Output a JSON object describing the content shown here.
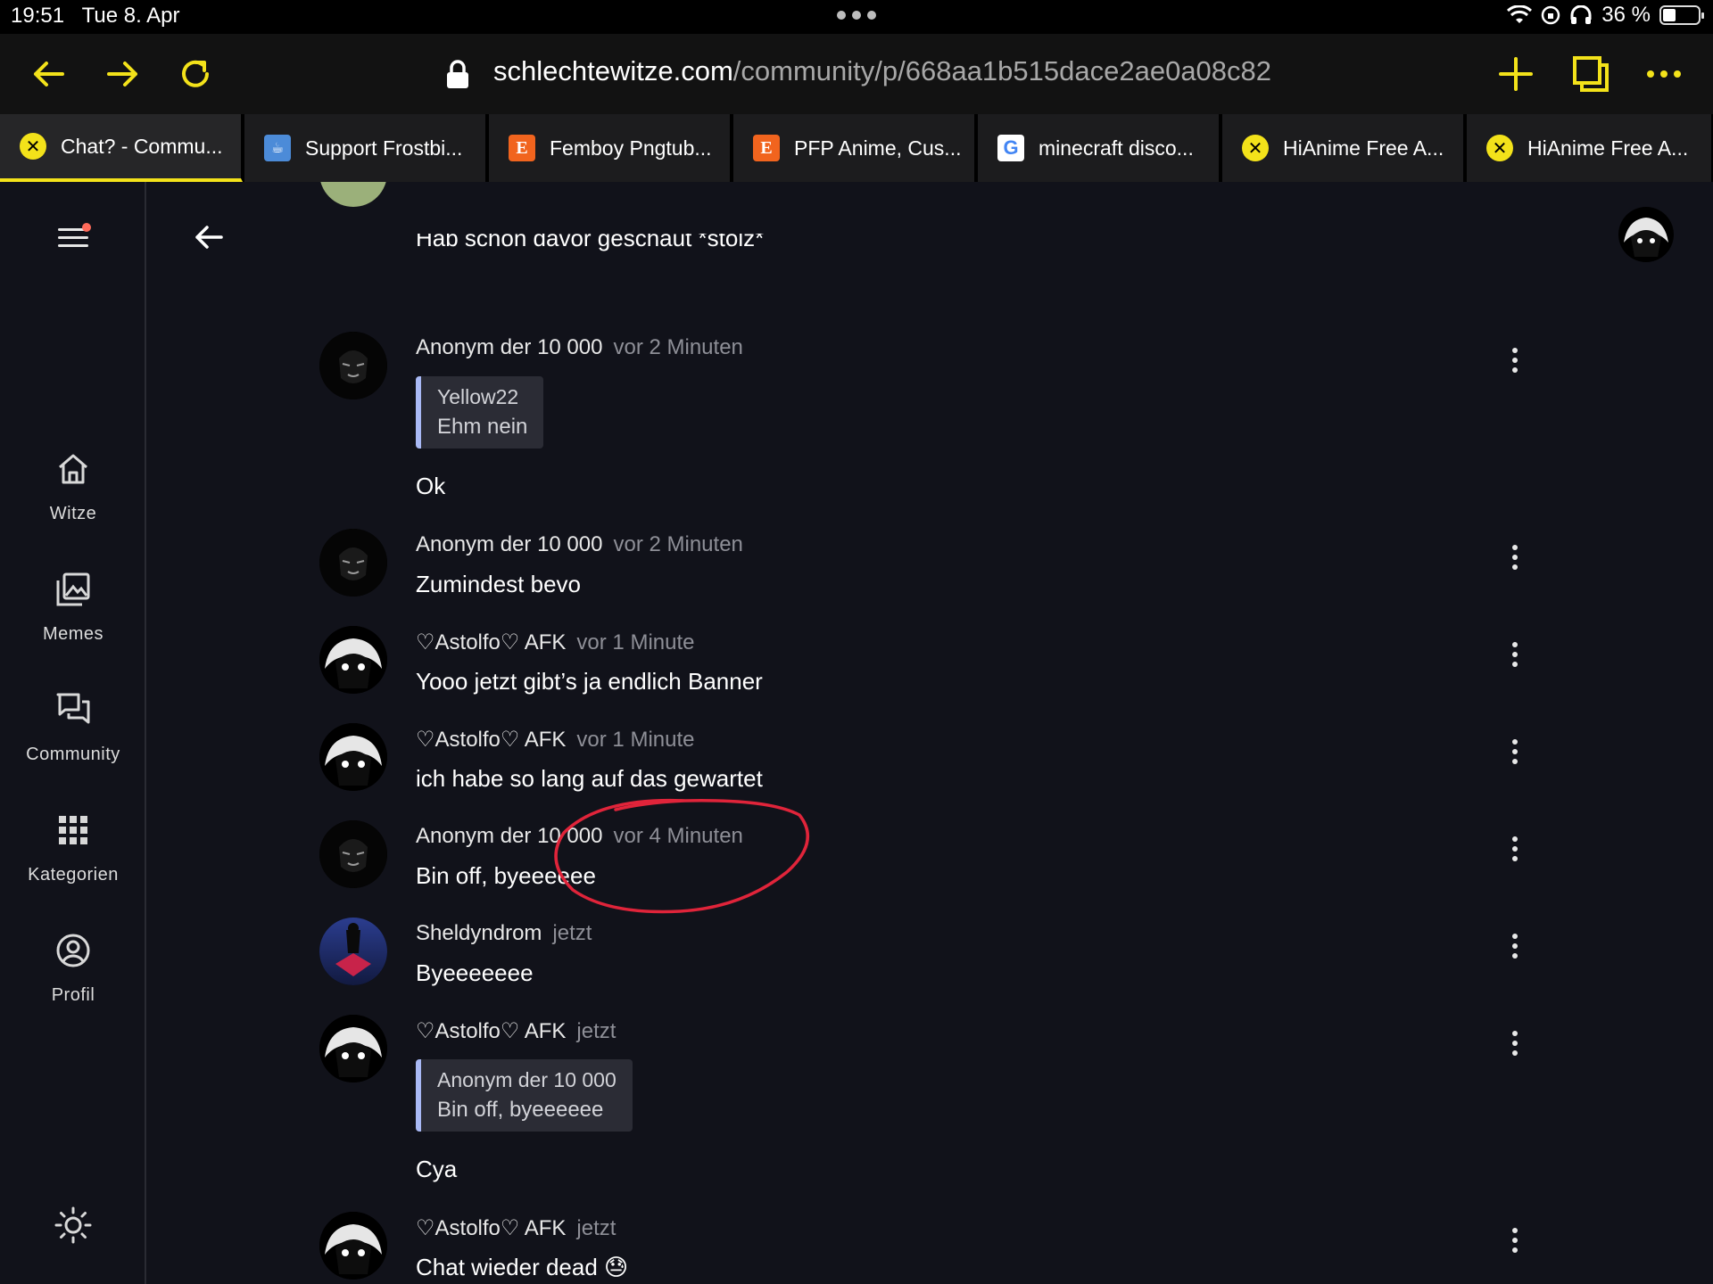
{
  "status_bar": {
    "time": "19:51",
    "date": "Tue 8. Apr",
    "battery": "36 %",
    "battery_level": 0.36
  },
  "browser": {
    "url_domain": "schlechtewitze.com",
    "url_path": "/community/p/668aa1b515dace2ae0a08c82",
    "accent_color": "#f3e21a",
    "tabs": [
      {
        "label": "Chat? - Commu...",
        "favicon": "x-circle-icon",
        "active": true
      },
      {
        "label": "Support Frostbi...",
        "favicon": "kofi-cup-icon"
      },
      {
        "label": "Femboy Pngtub...",
        "favicon": "etsy-icon"
      },
      {
        "label": "PFP Anime, Cus...",
        "favicon": "etsy-icon"
      },
      {
        "label": "minecraft disco...",
        "favicon": "google-icon"
      },
      {
        "label": "HiAnime Free A...",
        "favicon": "x-circle-icon"
      },
      {
        "label": "HiAnime Free A...",
        "favicon": "x-circle-icon"
      }
    ]
  },
  "sidebar": {
    "items": [
      {
        "label": "Witze",
        "icon": "home-icon"
      },
      {
        "label": "Memes",
        "icon": "images-icon"
      },
      {
        "label": "Community",
        "icon": "chat-bubbles-icon"
      },
      {
        "label": "Kategorien",
        "icon": "grid-icon"
      },
      {
        "label": "Profil",
        "icon": "user-circle-icon"
      }
    ]
  },
  "messages": [
    {
      "text": "Hab schon davor geschaut *stolz*"
    },
    {
      "author": "Anonym der 10 000",
      "time": "vor 2 Minuten",
      "quote_author": "Yellow22",
      "quote_text": "Ehm nein",
      "text": "Ok"
    },
    {
      "author": "Anonym der 10 000",
      "time": "vor 2 Minuten",
      "text": "Zumindest bevo"
    },
    {
      "author": "♡Astolfo♡ AFK",
      "time": "vor 1 Minute",
      "text": "Yooo jetzt gibt’s ja endlich Banner"
    },
    {
      "author": "♡Astolfo♡ AFK",
      "time": "vor 1 Minute",
      "text": "ich habe so lang auf das gewartet"
    },
    {
      "author": "Anonym der 10 000",
      "time": "vor 4 Minuten",
      "text": "Bin off, byeeeeee"
    },
    {
      "author": "Sheldyndrom",
      "time": "jetzt",
      "text": "Byeeeeeee"
    },
    {
      "author": "♡Astolfo♡ AFK",
      "time": "jetzt",
      "quote_author": "Anonym der 10 000",
      "quote_text": "Bin off, byeeeeee",
      "text": "Cya"
    },
    {
      "author": "♡Astolfo♡ AFK",
      "time": "jetzt",
      "text": "Chat wieder dead 😓"
    }
  ]
}
